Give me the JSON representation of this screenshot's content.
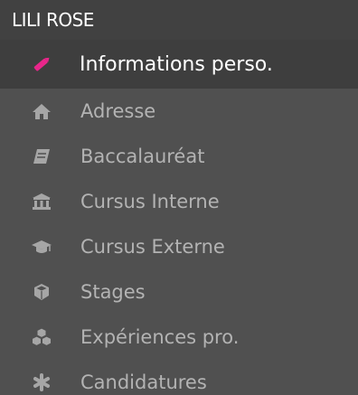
{
  "user": {
    "name": "LILI ROSE"
  },
  "menu": {
    "items": [
      {
        "label": "Informations perso.",
        "icon": "pencil-icon",
        "active": true
      },
      {
        "label": "Adresse",
        "icon": "home-icon",
        "active": false
      },
      {
        "label": "Baccalauréat",
        "icon": "book-icon",
        "active": false
      },
      {
        "label": "Cursus Interne",
        "icon": "institution-icon",
        "active": false
      },
      {
        "label": "Cursus Externe",
        "icon": "graduation-cap-icon",
        "active": false
      },
      {
        "label": "Stages",
        "icon": "cube-icon",
        "active": false
      },
      {
        "label": "Expériences pro.",
        "icon": "cubes-icon",
        "active": false
      },
      {
        "label": "Candidatures",
        "icon": "asterisk-icon",
        "active": false
      }
    ]
  },
  "colors": {
    "background": "#505050",
    "header_background": "#414141",
    "active_background": "#3e3e3e",
    "active_icon": "#e8268a",
    "inactive_text": "#b3b3b3",
    "inactive_icon": "#a6a6a6",
    "active_text": "#ffffff"
  }
}
